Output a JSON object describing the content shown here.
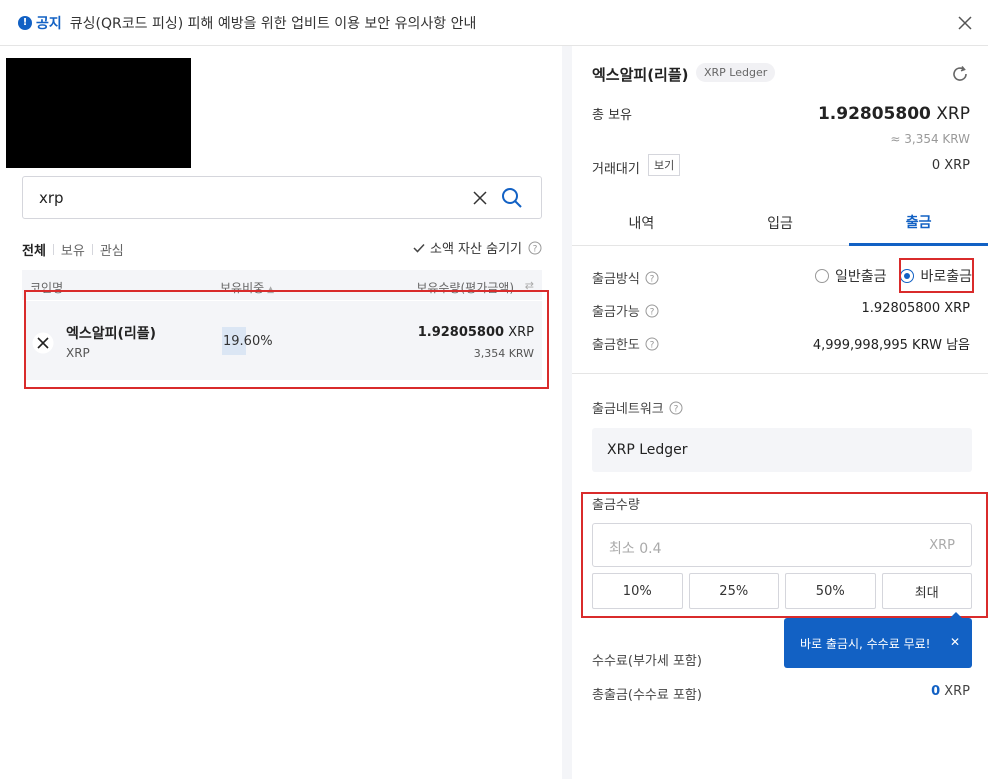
{
  "notice": {
    "label": "공지",
    "text": "큐싱(QR코드 피싱) 피해 예방을 위한 업비트 이용 보안 유의사항 안내"
  },
  "search": {
    "value": "xrp"
  },
  "filters": {
    "tabs": [
      "전체",
      "보유",
      "관심"
    ],
    "hide_small": "소액 자산 숨기기"
  },
  "table": {
    "headers": {
      "name": "코인명",
      "ratio": "보유비중",
      "amount": "보유수량(평가금액)"
    },
    "rows": [
      {
        "name": "엑스알피(리플)",
        "symbol": "XRP",
        "ratio": "19.60%",
        "ratio_value": 19.6,
        "amount": "1.92805800",
        "unit": "XRP",
        "krw": "3,354 KRW"
      }
    ]
  },
  "detail": {
    "title": "엑스알피(리플)",
    "network_tag": "XRP Ledger",
    "holding_label": "총 보유",
    "holding_amount": "1.92805800",
    "holding_unit": "XRP",
    "holding_krw": "≈ 3,354 KRW",
    "pending_label": "거래대기",
    "view_label": "보기",
    "pending_value": "0 XRP"
  },
  "tabs": [
    "내역",
    "입금",
    "출금"
  ],
  "withdraw": {
    "method_label": "출금방식",
    "method_options": [
      "일반출금",
      "바로출금"
    ],
    "selected_method": "바로출금",
    "available_label": "출금가능",
    "available_value": "1.92805800 XRP",
    "limit_label": "출금한도",
    "limit_value": "4,999,998,995 KRW 남음",
    "network_label": "출금네트워크",
    "network_value": "XRP Ledger",
    "amount_label": "출금수량",
    "amount_placeholder": "최소 0.4",
    "amount_unit": "XRP",
    "pct_buttons": [
      "10%",
      "25%",
      "50%",
      "최대"
    ],
    "fee_label": "수수료(부가세 포함)",
    "tooltip": "바로 출금시, 수수료 무료!",
    "total_label": "총출금(수수료 포함)",
    "total_amount": "0",
    "total_unit": "XRP"
  },
  "colors": {
    "accent": "#1261c4",
    "highlight_box": "#d92b2b",
    "row_bg": "#f4f5f8"
  },
  "icons": [
    "notice-icon",
    "close-icon",
    "search-clear-icon",
    "search-icon",
    "check-icon",
    "help-icon",
    "xrp-coin-icon",
    "reload-icon"
  ]
}
